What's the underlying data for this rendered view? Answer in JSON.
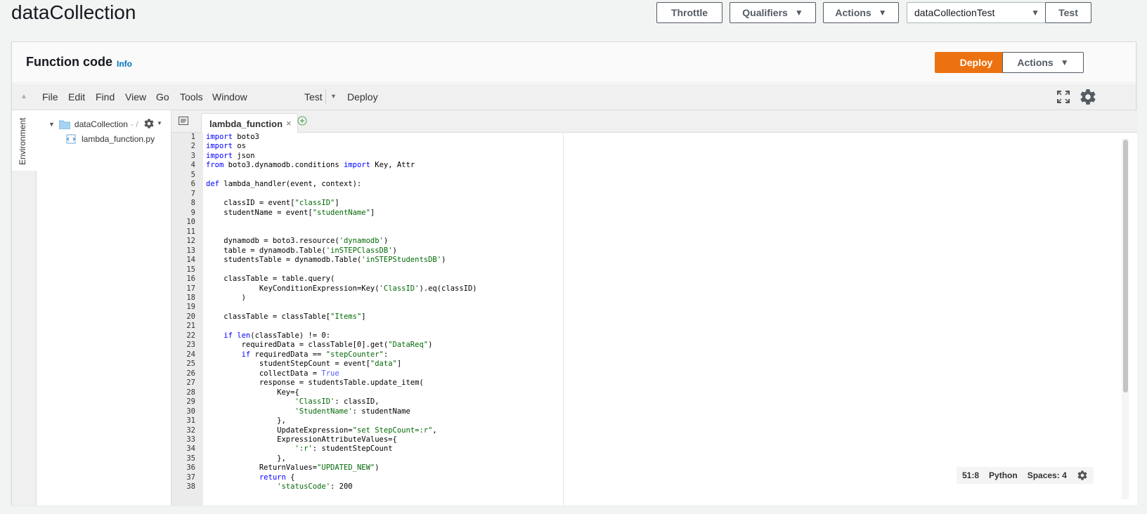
{
  "page": {
    "title": "dataCollection"
  },
  "header": {
    "throttle": "Throttle",
    "qualifiers": "Qualifiers",
    "actions": "Actions",
    "test_event": "dataCollectionTest",
    "test": "Test",
    "caret": "▼"
  },
  "panel": {
    "title": "Function code",
    "info": "Info",
    "deploy": "Deploy",
    "actions": "Actions"
  },
  "ide_menu": {
    "items": [
      "File",
      "Edit",
      "Find",
      "View",
      "Go",
      "Tools",
      "Window"
    ],
    "test": "Test",
    "deploy": "Deploy"
  },
  "environment": {
    "label": "Environment",
    "folder": "dataCollection",
    "folder_path": "- /",
    "file": "lambda_function.py"
  },
  "editor": {
    "tab_label": "lambda_function",
    "tab_close": "×",
    "lines": [
      "import boto3",
      "import os",
      "import json",
      "from boto3.dynamodb.conditions import Key, Attr",
      "",
      "def lambda_handler(event, context):",
      "",
      "    classID = event[\"classID\"]",
      "    studentName = event[\"studentName\"]",
      "",
      "",
      "    dynamodb = boto3.resource('dynamodb')",
      "    table = dynamodb.Table('inSTEPClassDB')",
      "    studentsTable = dynamodb.Table('inSTEPStudentsDB')",
      "",
      "    classTable = table.query(",
      "            KeyConditionExpression=Key('ClassID').eq(classID)",
      "        )",
      "",
      "    classTable = classTable[\"Items\"]",
      "",
      "    if len(classTable) != 0:",
      "        requiredData = classTable[0].get(\"DataReq\")",
      "        if requiredData == \"stepCounter\":",
      "            studentStepCount = event[\"data\"]",
      "            collectData = True",
      "            response = studentsTable.update_item(",
      "                Key={",
      "                    'ClassID': classID,",
      "                    'StudentName': studentName",
      "                },",
      "                UpdateExpression=\"set StepCount=:r\",",
      "                ExpressionAttributeValues={",
      "                    ':r': studentStepCount",
      "                },",
      "            ReturnValues=\"UPDATED_NEW\")",
      "            return {",
      "                'statusCode': 200"
    ]
  },
  "status": {
    "cursor": "51:8",
    "language": "Python",
    "spaces": "Spaces: 4"
  }
}
